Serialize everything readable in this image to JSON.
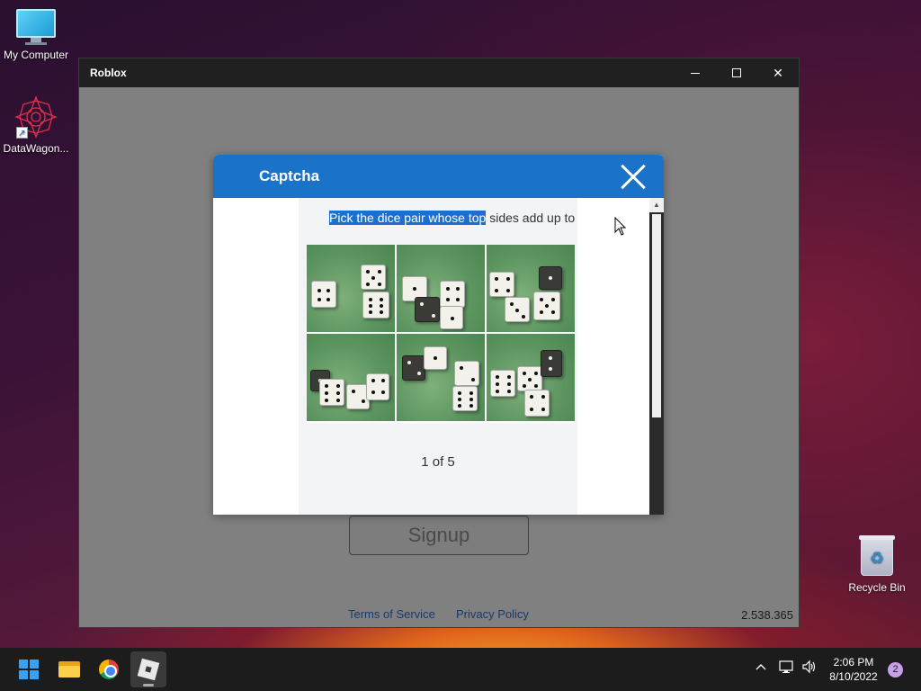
{
  "desktop": {
    "icons": {
      "my_computer": "My Computer",
      "datawagon": "DataWagon...",
      "recycle_bin": "Recycle Bin"
    }
  },
  "window": {
    "title": "Roblox",
    "controls": {
      "minimize": "–",
      "close": "✕"
    },
    "signup_label": "Signup",
    "links": {
      "tos": "Terms of Service",
      "privacy": "Privacy Policy"
    },
    "version": "2.538.365"
  },
  "captcha": {
    "title": "Captcha",
    "instruction_highlighted": "Pick the dice pair whose top",
    "instruction_rest": " sides add up to",
    "progress": "1 of 5",
    "accent_color": "#1a73c8"
  },
  "taskbar": {
    "apps": [
      "start-icon",
      "file-explorer-icon",
      "chrome-icon",
      "roblox-icon"
    ],
    "tray": {
      "chevron": "^",
      "network": "network-icon",
      "volume": "volume-icon"
    },
    "time": "2:06 PM",
    "date": "8/10/2022",
    "notifications": "2"
  }
}
